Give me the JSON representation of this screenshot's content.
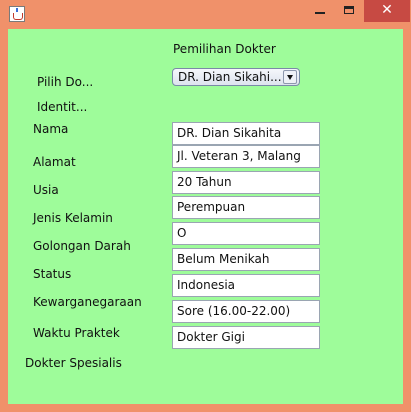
{
  "window": {
    "title": "",
    "close_glyph": "✕",
    "icon": "java-cup-icon"
  },
  "heading": "Pemilihan Dokter",
  "combo": {
    "label": "Pilih Do...",
    "selected": "DR. Dian Sikahi..."
  },
  "identity_label": "Identit...",
  "rows": [
    {
      "label": "Nama",
      "value": "DR. Dian Sikahita"
    },
    {
      "label": "Alamat",
      "value": "Jl. Veteran 3, Malang"
    },
    {
      "label": "Usia",
      "value": "20 Tahun"
    },
    {
      "label": "Jenis Kelamin",
      "value": "Perempuan"
    },
    {
      "label": "Golongan Darah",
      "value": "O"
    },
    {
      "label": "Status",
      "value": "Belum Menikah"
    },
    {
      "label": "Kewarganegaraan",
      "value": "Indonesia"
    },
    {
      "label": "Waktu Praktek",
      "value": " Sore (16.00-22.00)"
    },
    {
      "label": "Dokter Spesialis",
      "value": "Dokter Gigi"
    }
  ]
}
